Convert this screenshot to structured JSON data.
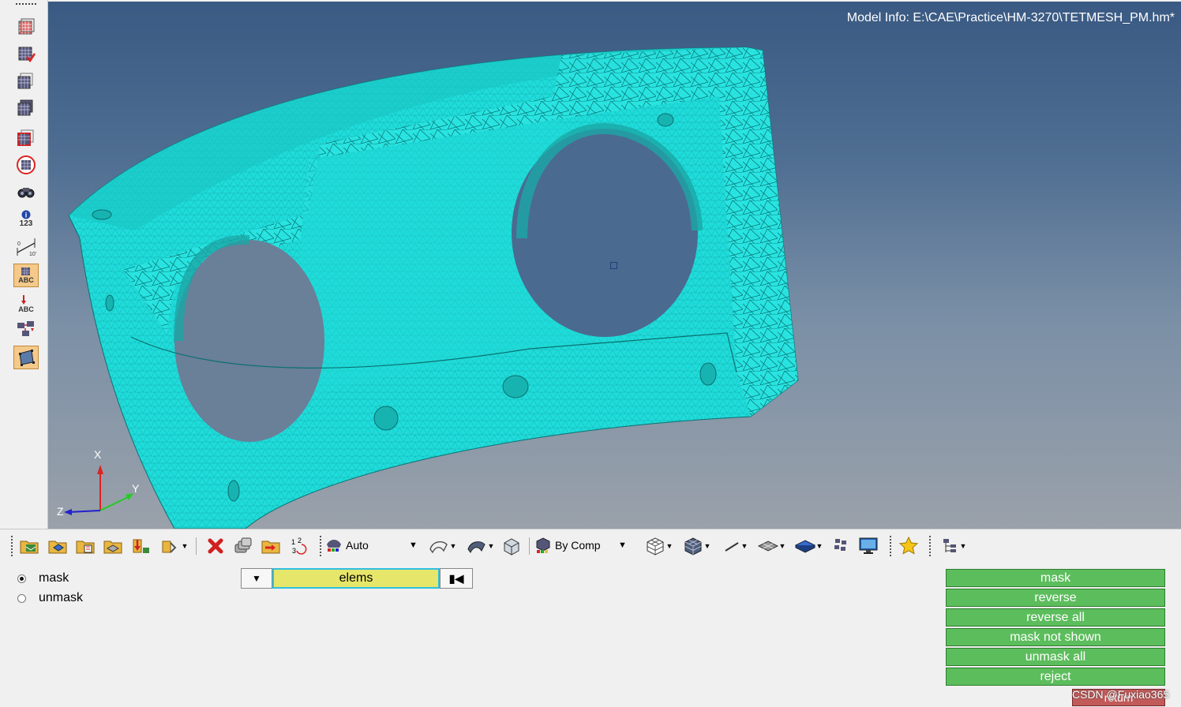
{
  "viewport": {
    "model_info": "Model Info: E:\\CAE\\Practice\\HM-3270\\TETMESH_PM.hm*",
    "axis_labels": {
      "x": "X",
      "y": "Y",
      "z": "Z"
    },
    "mesh_color": "#1fe0de",
    "background_top": "#3a5a83",
    "background_bottom": "#9aa1aa"
  },
  "left_toolbar": {
    "icons": [
      "mask-icon",
      "unmask-icon",
      "show-icon",
      "hide-icon",
      "isolate-icon",
      "reverse-icon",
      "find-icon",
      "numbers-icon",
      "measure-icon",
      "label-icon",
      "label-arrow-icon",
      "reorder-icon",
      "plane-icon"
    ],
    "label_text": "ABC",
    "numbers_text": "123"
  },
  "bottom_toolbar": {
    "auto_label": "Auto",
    "bycomp_label": "By Comp"
  },
  "panel": {
    "radio_options": [
      {
        "label": "mask",
        "selected": true
      },
      {
        "label": "unmask",
        "selected": false
      }
    ],
    "entity_selector": "elems",
    "buttons": [
      "mask",
      "reverse",
      "reverse all",
      "mask not shown",
      "unmask all",
      "reject"
    ],
    "return_label": "return",
    "watermark": "CSDN @Fuxiao365"
  },
  "colors": {
    "action_button": "#5cbd5c",
    "return_button": "#c25a5a",
    "selector_field": "#e6e66a",
    "selector_border": "#2fbfe0"
  }
}
